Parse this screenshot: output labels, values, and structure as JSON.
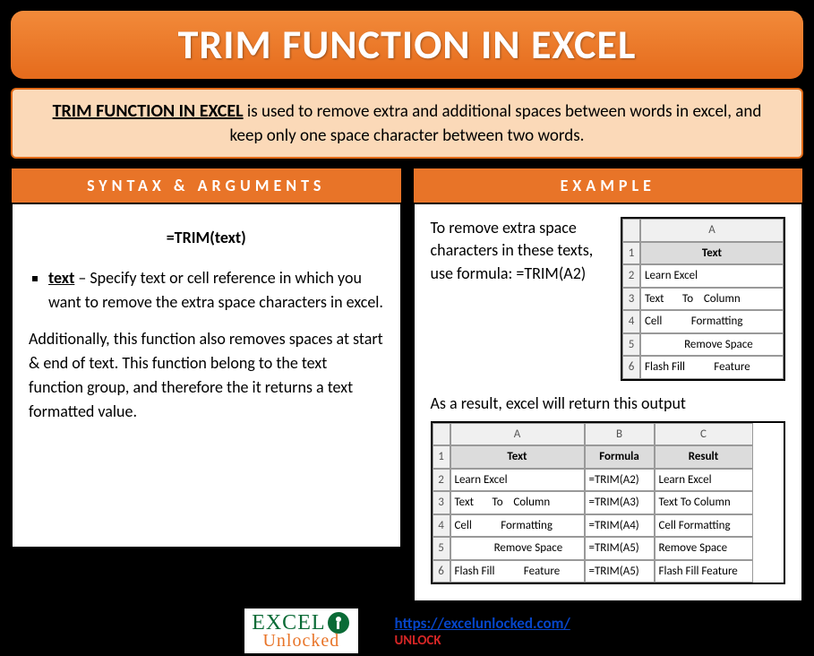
{
  "title": "TRIM FUNCTION IN EXCEL",
  "intro": {
    "lead": "TRIM FUNCTION IN EXCEL",
    "rest": " is used to remove extra and additional spaces between words in excel, and keep only one space character between two words."
  },
  "left": {
    "heading": "SYNTAX & ARGUMENTS",
    "syntax": "=TRIM(text)",
    "arg_name": "text",
    "arg_desc": " – Specify text or cell reference in which you want to remove the extra space characters in excel.",
    "note": "Additionally, this function also removes spaces at start & end of text. This function belong to the text function group, and therefore the it returns a text formatted value."
  },
  "right": {
    "heading": "EXAMPLE",
    "top_text": "To remove extra space characters in these texts, use formula: =TRIM(A2)",
    "result_text": "As a result, excel will return this output",
    "grid1": {
      "col_heads": [
        "A"
      ],
      "header_row": [
        "Text"
      ],
      "rows": [
        [
          "Learn Excel"
        ],
        [
          "Text       To    Column"
        ],
        [
          "Cell           Formatting"
        ],
        [
          "               Remove Space"
        ],
        [
          "Flash Fill           Feature"
        ]
      ]
    },
    "grid2": {
      "col_heads": [
        "A",
        "B",
        "C"
      ],
      "header_row": [
        "Text",
        "Formula",
        "Result"
      ],
      "rows": [
        [
          "Learn Excel",
          "=TRIM(A2)",
          "Learn Excel"
        ],
        [
          "Text       To    Column",
          "=TRIM(A3)",
          "Text To Column"
        ],
        [
          "Cell           Formatting",
          "=TRIM(A4)",
          "Cell Formatting"
        ],
        [
          "               Remove Space",
          "=TRIM(A5)",
          "Remove Space"
        ],
        [
          "Flash Fill           Feature",
          "=TRIM(A5)",
          "Flash Fill Feature"
        ]
      ]
    }
  },
  "footer": {
    "logo_excel": "EXCEL",
    "logo_unlocked": "Unlocked",
    "link_text": "https://excelunlocked.com/",
    "link_href": "https://excelunlocked.com/",
    "unlock": "UNLOCK"
  }
}
